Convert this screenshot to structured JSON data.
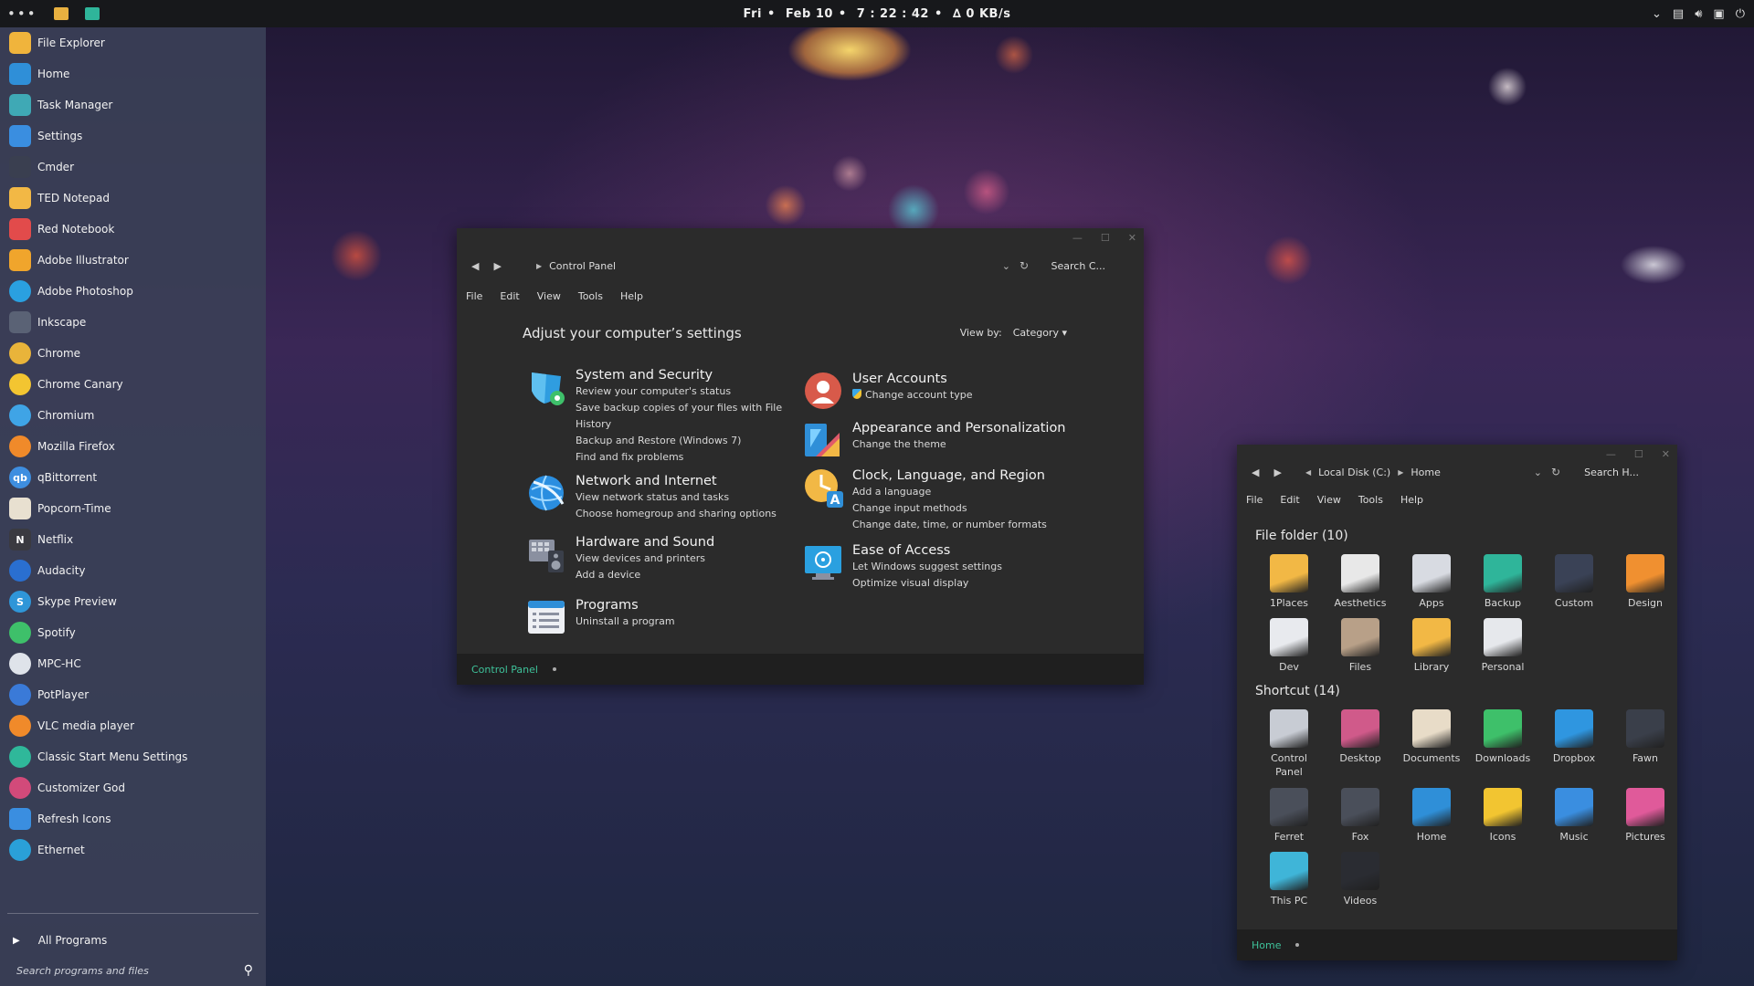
{
  "topbar": {
    "dots": "•••",
    "day": "Fri",
    "date": "Feb 10",
    "time": "7 : 22 : 42",
    "net": "∆ 0 KB/s"
  },
  "startmenu": {
    "items": [
      {
        "label": "File Explorer",
        "icon": "folder-icon",
        "color": "#f0b43c"
      },
      {
        "label": "Home",
        "icon": "home-folder-icon",
        "color": "#2f8fd8"
      },
      {
        "label": "Task Manager",
        "icon": "task-manager-icon",
        "color": "#3fa9b5"
      },
      {
        "label": "Settings",
        "icon": "gear-icon",
        "color": "#3a8ee0"
      },
      {
        "label": "Cmder",
        "icon": "terminal-icon",
        "color": "#3a3f50"
      },
      {
        "label": "TED Notepad",
        "icon": "notepad-icon",
        "color": "#f2b845"
      },
      {
        "label": "Red Notebook",
        "icon": "notebook-icon",
        "color": "#e24b4b"
      },
      {
        "label": "Adobe Illustrator",
        "icon": "illustrator-icon",
        "color": "#f0a52c"
      },
      {
        "label": "Adobe Photoshop",
        "icon": "photoshop-icon",
        "color": "#2aa0e0"
      },
      {
        "label": "Inkscape",
        "icon": "inkscape-icon",
        "color": "#5a6275"
      },
      {
        "label": "Chrome",
        "icon": "chrome-icon",
        "color": "#e9b43a"
      },
      {
        "label": "Chrome Canary",
        "icon": "chrome-canary-icon",
        "color": "#f3c531"
      },
      {
        "label": "Chromium",
        "icon": "chromium-icon",
        "color": "#3fa4e6"
      },
      {
        "label": "Mozilla Firefox",
        "icon": "firefox-icon",
        "color": "#f08a2a"
      },
      {
        "label": "qBittorrent",
        "icon": "qbittorrent-icon",
        "color": "#3e8ee0",
        "glyph": "qb"
      },
      {
        "label": "Popcorn-Time",
        "icon": "popcorn-icon",
        "color": "#e8e0d0"
      },
      {
        "label": "Netflix",
        "icon": "netflix-icon",
        "color": "#3a3a40",
        "glyph": "N"
      },
      {
        "label": "Audacity",
        "icon": "audacity-icon",
        "color": "#2a6fd0"
      },
      {
        "label": "Skype Preview",
        "icon": "skype-icon",
        "color": "#2f96d8",
        "glyph": "S"
      },
      {
        "label": "Spotify",
        "icon": "spotify-icon",
        "color": "#3ec06a"
      },
      {
        "label": "MPC-HC",
        "icon": "mpc-hc-icon",
        "color": "#dfe3ea"
      },
      {
        "label": "PotPlayer",
        "icon": "potplayer-icon",
        "color": "#3a7ad8"
      },
      {
        "label": "VLC media player",
        "icon": "vlc-icon",
        "color": "#f08a2a"
      },
      {
        "label": "Classic Start Menu Settings",
        "icon": "classic-start-icon",
        "color": "#2fb89a"
      },
      {
        "label": "Customizer God",
        "icon": "customizer-icon",
        "color": "#d24a7a"
      },
      {
        "label": "Refresh Icons",
        "icon": "refresh-icon",
        "color": "#3a8ee0"
      },
      {
        "label": "Ethernet",
        "icon": "ethernet-icon",
        "color": "#2aa0d8"
      }
    ],
    "all_programs": "All Programs",
    "search_placeholder": "Search programs and files"
  },
  "control_panel": {
    "breadcrumb": "Control Panel",
    "search": "Search C...",
    "menus": [
      "File",
      "Edit",
      "View",
      "Tools",
      "Help"
    ],
    "heading": "Adjust your computer’s settings",
    "view_by_label": "View by:",
    "view_by_value": "Category",
    "left": [
      {
        "title": "System and Security",
        "links": [
          "Review your computer's status",
          "Save backup copies of your files with File",
          "History",
          "Backup and Restore (Windows 7)",
          "Find and fix problems"
        ]
      },
      {
        "title": "Network and Internet",
        "links": [
          "View network status and tasks",
          "Choose homegroup and sharing options"
        ]
      },
      {
        "title": "Hardware and Sound",
        "links": [
          "View devices and printers",
          "Add a device"
        ]
      },
      {
        "title": "Programs",
        "links": [
          "Uninstall a program"
        ]
      }
    ],
    "right": [
      {
        "title": "User Accounts",
        "links": [
          "Change account type"
        ]
      },
      {
        "title": "Appearance and Personalization",
        "links": [
          "Change the theme"
        ]
      },
      {
        "title": "Clock, Language, and Region",
        "links": [
          "Add a language",
          "Change input methods",
          "Change date, time, or number formats"
        ]
      },
      {
        "title": "Ease of Access",
        "links": [
          "Let Windows suggest settings",
          "Optimize visual display"
        ]
      }
    ],
    "status": "Control Panel"
  },
  "explorer": {
    "crumb1": "Local Disk (C:)",
    "crumb2": "Home",
    "search": "Search H...",
    "menus": [
      "File",
      "Edit",
      "View",
      "Tools",
      "Help"
    ],
    "folders_heading": "File folder (10)",
    "folders": [
      {
        "name": "1Places",
        "color": "#f2b845"
      },
      {
        "name": "Aesthetics",
        "color": "#e8e8e8"
      },
      {
        "name": "Apps",
        "color": "#d8dbe2"
      },
      {
        "name": "Backup",
        "color": "#2fb59a"
      },
      {
        "name": "Custom",
        "color": "#3a4256"
      },
      {
        "name": "Design",
        "color": "#f09030"
      },
      {
        "name": "Dev",
        "color": "#e8eaee"
      },
      {
        "name": "Files",
        "color": "#b8a088"
      },
      {
        "name": "Library",
        "color": "#f2b845"
      },
      {
        "name": "Personal",
        "color": "#e6e8ec"
      }
    ],
    "shortcuts_heading": "Shortcut (14)",
    "shortcuts": [
      {
        "name": "Control Panel",
        "color": "#c8ccd4"
      },
      {
        "name": "Desktop",
        "color": "#d05a8a"
      },
      {
        "name": "Documents",
        "color": "#e8dcc8"
      },
      {
        "name": "Downloads",
        "color": "#3ec06a"
      },
      {
        "name": "Dropbox",
        "color": "#2f96e0"
      },
      {
        "name": "Fawn",
        "color": "#3a3f4a"
      },
      {
        "name": "Ferret",
        "color": "#4a4f5a"
      },
      {
        "name": "Fox",
        "color": "#4a4f5a"
      },
      {
        "name": "Home",
        "color": "#2f8fd8"
      },
      {
        "name": "Icons",
        "color": "#f2c531"
      },
      {
        "name": "Music",
        "color": "#3a8ee0"
      },
      {
        "name": "Pictures",
        "color": "#e05a9a"
      },
      {
        "name": "This PC",
        "color": "#3fb5d8"
      },
      {
        "name": "Videos",
        "color": "#2a2c32"
      }
    ],
    "status": "Home"
  }
}
